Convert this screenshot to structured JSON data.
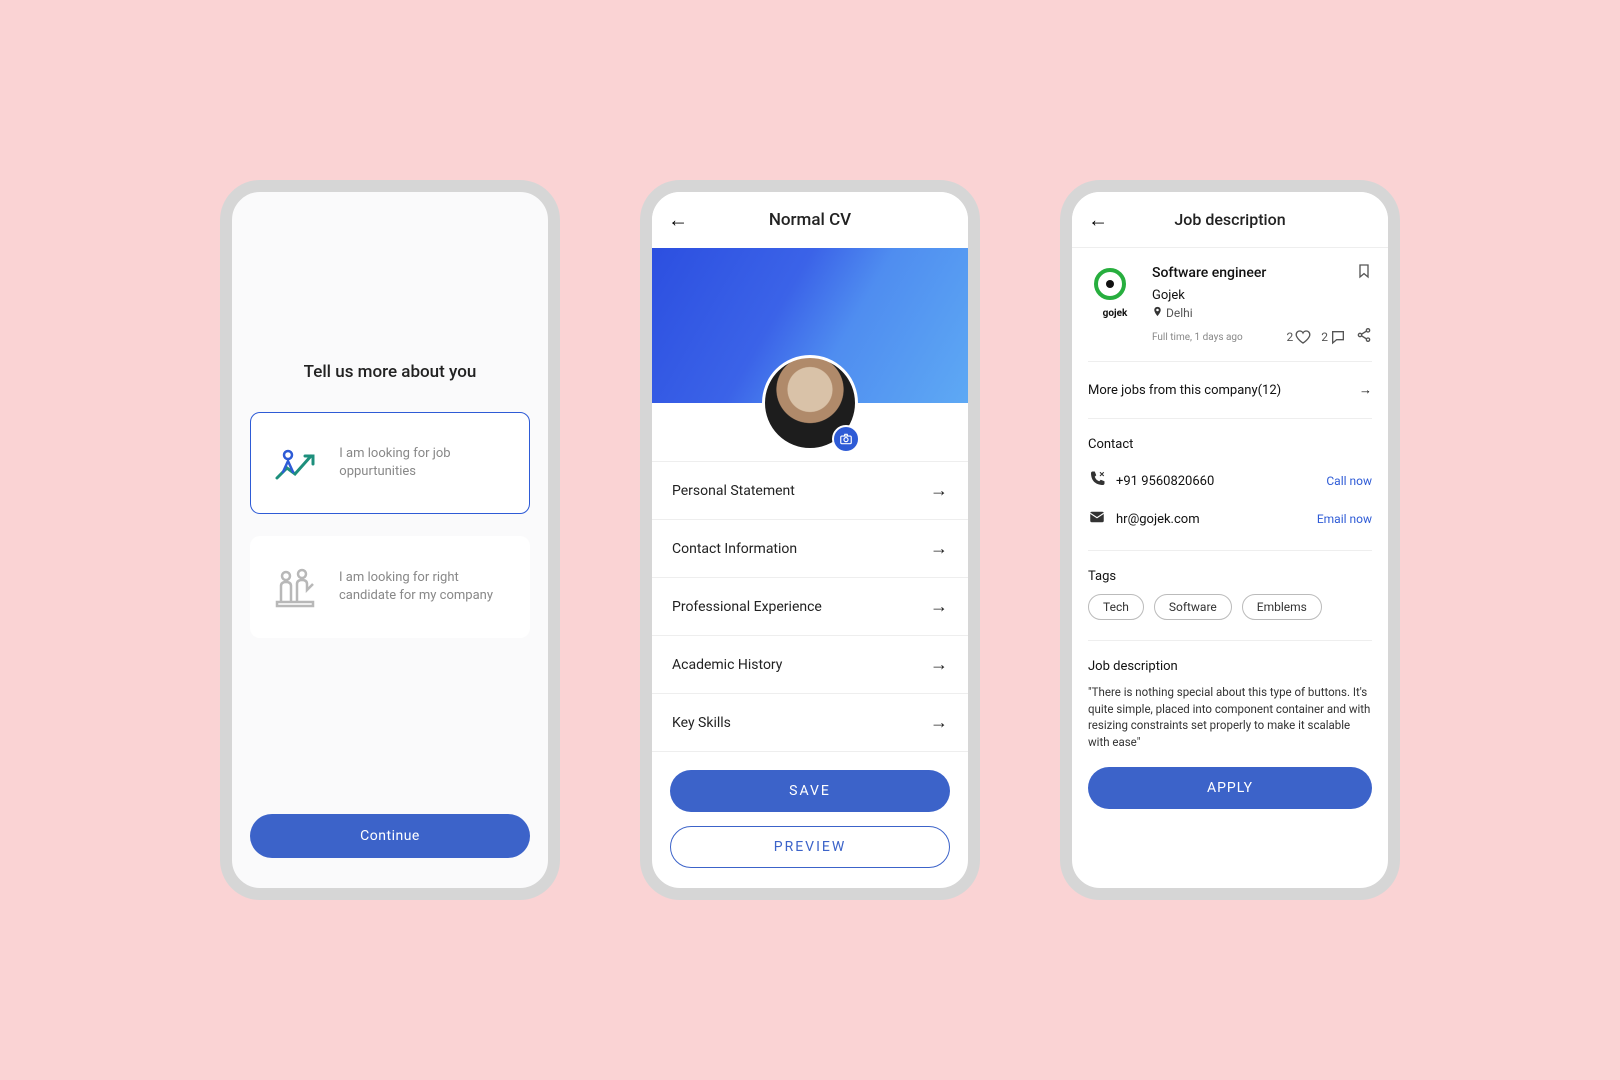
{
  "screen1": {
    "title": "Tell us more about you",
    "options": [
      {
        "label": "I am looking for job oppurtunities",
        "selected": true
      },
      {
        "label": "I am looking for right candidate for my company",
        "selected": false
      }
    ],
    "continue": "Continue"
  },
  "screen2": {
    "title": "Normal CV",
    "sections": [
      "Personal Statement",
      "Contact Information",
      "Professional Experience",
      "Academic History",
      "Key Skills"
    ],
    "save": "SAVE",
    "preview": "PREVIEW"
  },
  "screen3": {
    "title": "Job description",
    "job": {
      "role": "Software engineer",
      "company": "Gojek",
      "company_logo_label": "gojek",
      "location": "Delhi",
      "meta": "Full time, 1 days ago",
      "likes": "2",
      "comments": "2"
    },
    "more_jobs": "More jobs from this company(12)",
    "contact": {
      "heading": "Contact",
      "phone": "+91 9560820660",
      "phone_action": "Call now",
      "email": "hr@gojek.com",
      "email_action": "Email now"
    },
    "tags_heading": "Tags",
    "tags": [
      "Tech",
      "Software",
      "Emblems"
    ],
    "desc_heading": "Job description",
    "desc_text": "\"There is nothing special about this type of buttons. It's quite simple, placed into component container and with resizing constraints set properly to make it scalable with ease\"",
    "apply": "APPLY"
  }
}
